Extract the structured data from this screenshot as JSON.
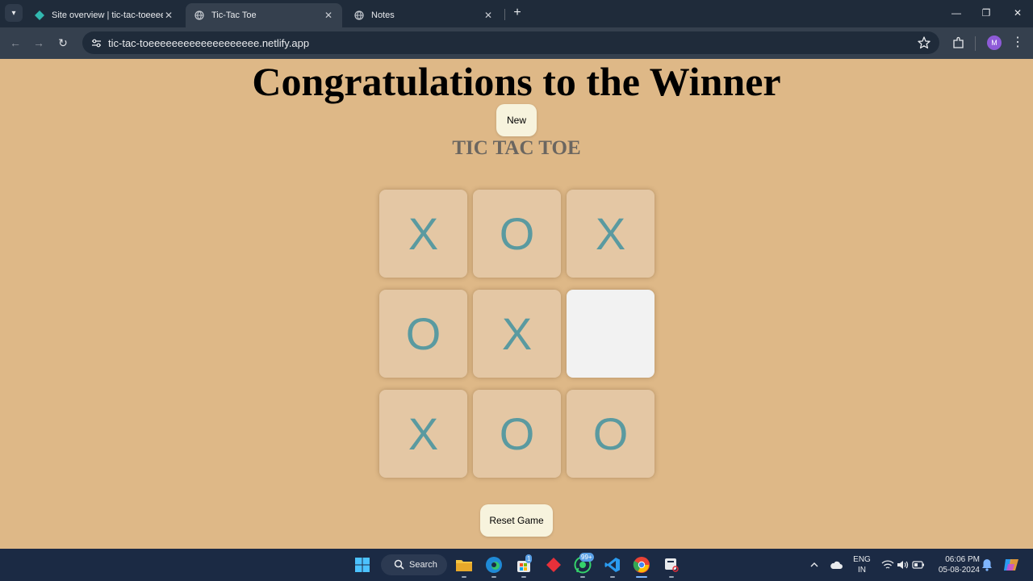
{
  "browser": {
    "tabs": [
      {
        "title": "Site overview | tic-tac-toeeeee",
        "active": false
      },
      {
        "title": "Tic-Tac Toe",
        "active": true
      },
      {
        "title": "Notes",
        "active": false
      }
    ],
    "url": "tic-tac-toeeeeeeeeeeeeeeeeeee.netlify.app",
    "profile_initial": "M"
  },
  "page": {
    "winner_message": "Congratulations to the Winner",
    "new_button": "New",
    "game_title": "TIC TAC TOE",
    "board": [
      "X",
      "O",
      "X",
      "O",
      "X",
      "",
      "X",
      "O",
      "O"
    ],
    "reset_button": "Reset Game"
  },
  "taskbar": {
    "search_label": "Search",
    "store_badge": "1",
    "whatsapp_badge": "99+",
    "language": "ENG",
    "region": "IN",
    "time": "06:06 PM",
    "date": "05-08-2024"
  },
  "colors": {
    "page_background": "#deb887",
    "cell_background": "#e4c7a4",
    "empty_cell_background": "#f2f2f2",
    "mark_color": "#5a9aa0",
    "button_background": "#f7f3dd"
  }
}
